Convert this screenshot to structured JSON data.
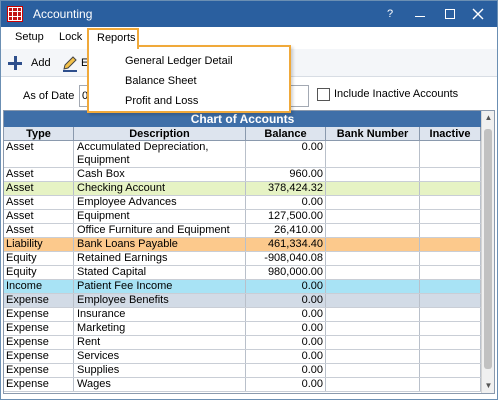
{
  "window": {
    "title": "Accounting",
    "help_label": "?"
  },
  "menu": {
    "setup": "Setup",
    "lock": "Lock",
    "reports": "Reports",
    "reports_items": [
      "General Ledger Detail",
      "Balance Sheet",
      "Profit and Loss"
    ]
  },
  "toolbar": {
    "add_label": "Add",
    "edit_label": "E"
  },
  "filter": {
    "as_of_label": "As of Date",
    "as_of_value": "0",
    "include_inactive_label": "Include Inactive Accounts",
    "include_inactive_checked": false
  },
  "grid": {
    "title": "Chart of Accounts",
    "headers": {
      "type": "Type",
      "description": "Description",
      "balance": "Balance",
      "bank_number": "Bank Number",
      "inactive": "Inactive"
    },
    "rows": [
      {
        "type": "Asset",
        "description": "Accumulated Depreciation, Equipment",
        "balance": "0.00",
        "color": "#ffffff",
        "tall": true
      },
      {
        "type": "Asset",
        "description": "Cash Box",
        "balance": "960.00",
        "color": "#ffffff"
      },
      {
        "type": "Asset",
        "description": "Checking Account",
        "balance": "378,424.32",
        "color": "#e6f3c4"
      },
      {
        "type": "Asset",
        "description": "Employee Advances",
        "balance": "0.00",
        "color": "#ffffff"
      },
      {
        "type": "Asset",
        "description": "Equipment",
        "balance": "127,500.00",
        "color": "#ffffff"
      },
      {
        "type": "Asset",
        "description": "Office Furniture and Equipment",
        "balance": "26,410.00",
        "color": "#ffffff"
      },
      {
        "type": "Liability",
        "description": "Bank Loans Payable",
        "balance": "461,334.40",
        "color": "#fcc98c"
      },
      {
        "type": "Equity",
        "description": "Retained Earnings",
        "balance": "-908,040.08",
        "color": "#ffffff"
      },
      {
        "type": "Equity",
        "description": "Stated Capital",
        "balance": "980,000.00",
        "color": "#ffffff"
      },
      {
        "type": "Income",
        "description": "Patient Fee Income",
        "balance": "0.00",
        "color": "#a8e3f5"
      },
      {
        "type": "Expense",
        "description": "Employee Benefits",
        "balance": "0.00",
        "color": "#d2dbe6"
      },
      {
        "type": "Expense",
        "description": "Insurance",
        "balance": "0.00",
        "color": "#ffffff"
      },
      {
        "type": "Expense",
        "description": "Marketing",
        "balance": "0.00",
        "color": "#ffffff"
      },
      {
        "type": "Expense",
        "description": "Rent",
        "balance": "0.00",
        "color": "#ffffff"
      },
      {
        "type": "Expense",
        "description": "Services",
        "balance": "0.00",
        "color": "#ffffff"
      },
      {
        "type": "Expense",
        "description": "Supplies",
        "balance": "0.00",
        "color": "#ffffff"
      },
      {
        "type": "Expense",
        "description": "Wages",
        "balance": "0.00",
        "color": "#ffffff"
      }
    ]
  }
}
